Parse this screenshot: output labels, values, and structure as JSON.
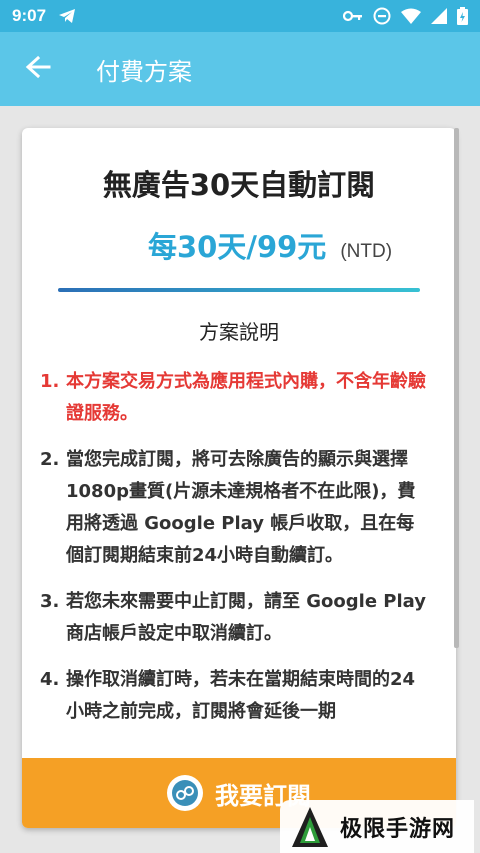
{
  "status_bar": {
    "time": "9:07",
    "left_icon": "telegram-icon",
    "right_icons": [
      "vpn-key-icon",
      "do-not-disturb-icon",
      "wifi-icon",
      "signal-icon",
      "battery-icon"
    ]
  },
  "app_bar": {
    "title": "付費方案",
    "back_icon": "arrow-back-icon"
  },
  "plan": {
    "title": "無廣告30天自動訂閱",
    "price": "每30天/99元",
    "currency": "(NTD)",
    "description_heading": "方案說明",
    "terms": [
      {
        "num": "1.",
        "text": "本方案交易方式為應用程式內購，不含年齡驗證服務。"
      },
      {
        "num": "2.",
        "text": "當您完成訂閱，將可去除廣告的顯示與選擇1080p畫質(片源未達規格者不在此限)，費用將透過 Google Play 帳戶收取，且在每個訂閱期結束前24小時自動續訂。"
      },
      {
        "num": "3.",
        "text": "若您未來需要中止訂閱，請至 Google Play 商店帳戶設定中取消續訂。"
      },
      {
        "num": "4.",
        "text": "操作取消續訂時，若未在當期結束時間的24小時之前完成，訂閱將會延後一期"
      }
    ]
  },
  "subscribe": {
    "label": "我要訂閱",
    "icon": "subscribe-badge-icon"
  },
  "watermark": {
    "text": "极限手游网"
  },
  "colors": {
    "status_bar": "#38b3dc",
    "app_bar": "#5bc6e8",
    "price": "#2aa6d6",
    "highlight": "#e53935",
    "button": "#f5a025"
  }
}
